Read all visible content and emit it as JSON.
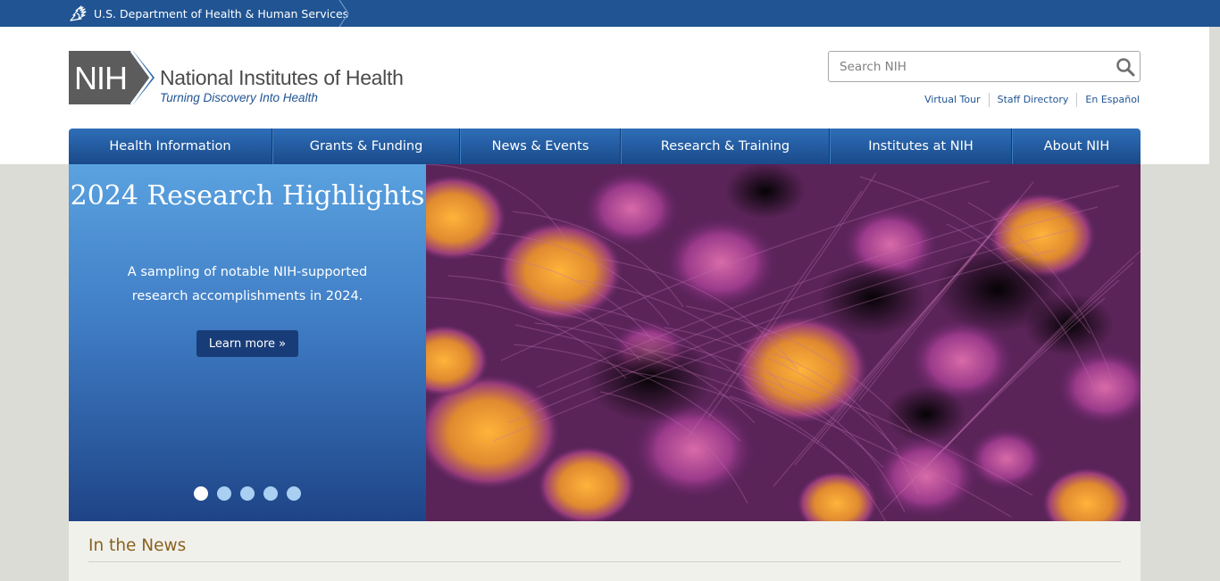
{
  "hhs_bar": {
    "label": "U.S. Department of Health & Human Services"
  },
  "logo": {
    "mark": "NIH",
    "title": "National Institutes of Health",
    "tagline": "Turning Discovery Into Health"
  },
  "search": {
    "placeholder": "Search NIH",
    "value": ""
  },
  "utility_links": [
    "Virtual Tour",
    "Staff Directory",
    "En Español"
  ],
  "nav": {
    "items": [
      "Health Information",
      "Grants & Funding",
      "News & Events",
      "Research & Training",
      "Institutes at NIH",
      "About NIH"
    ]
  },
  "hero": {
    "title": "2024 Research Highlights",
    "text": "A sampling of notable NIH-supported research accomplishments in 2024.",
    "button": "Learn more »",
    "slide_count": 5,
    "active_slide": 1
  },
  "news": {
    "title": "In the News"
  },
  "colors": {
    "brand_blue": "#205493",
    "nav_top": "#2e6eb8",
    "nav_bottom": "#1a4a8a",
    "news_heading": "#8a6220"
  }
}
